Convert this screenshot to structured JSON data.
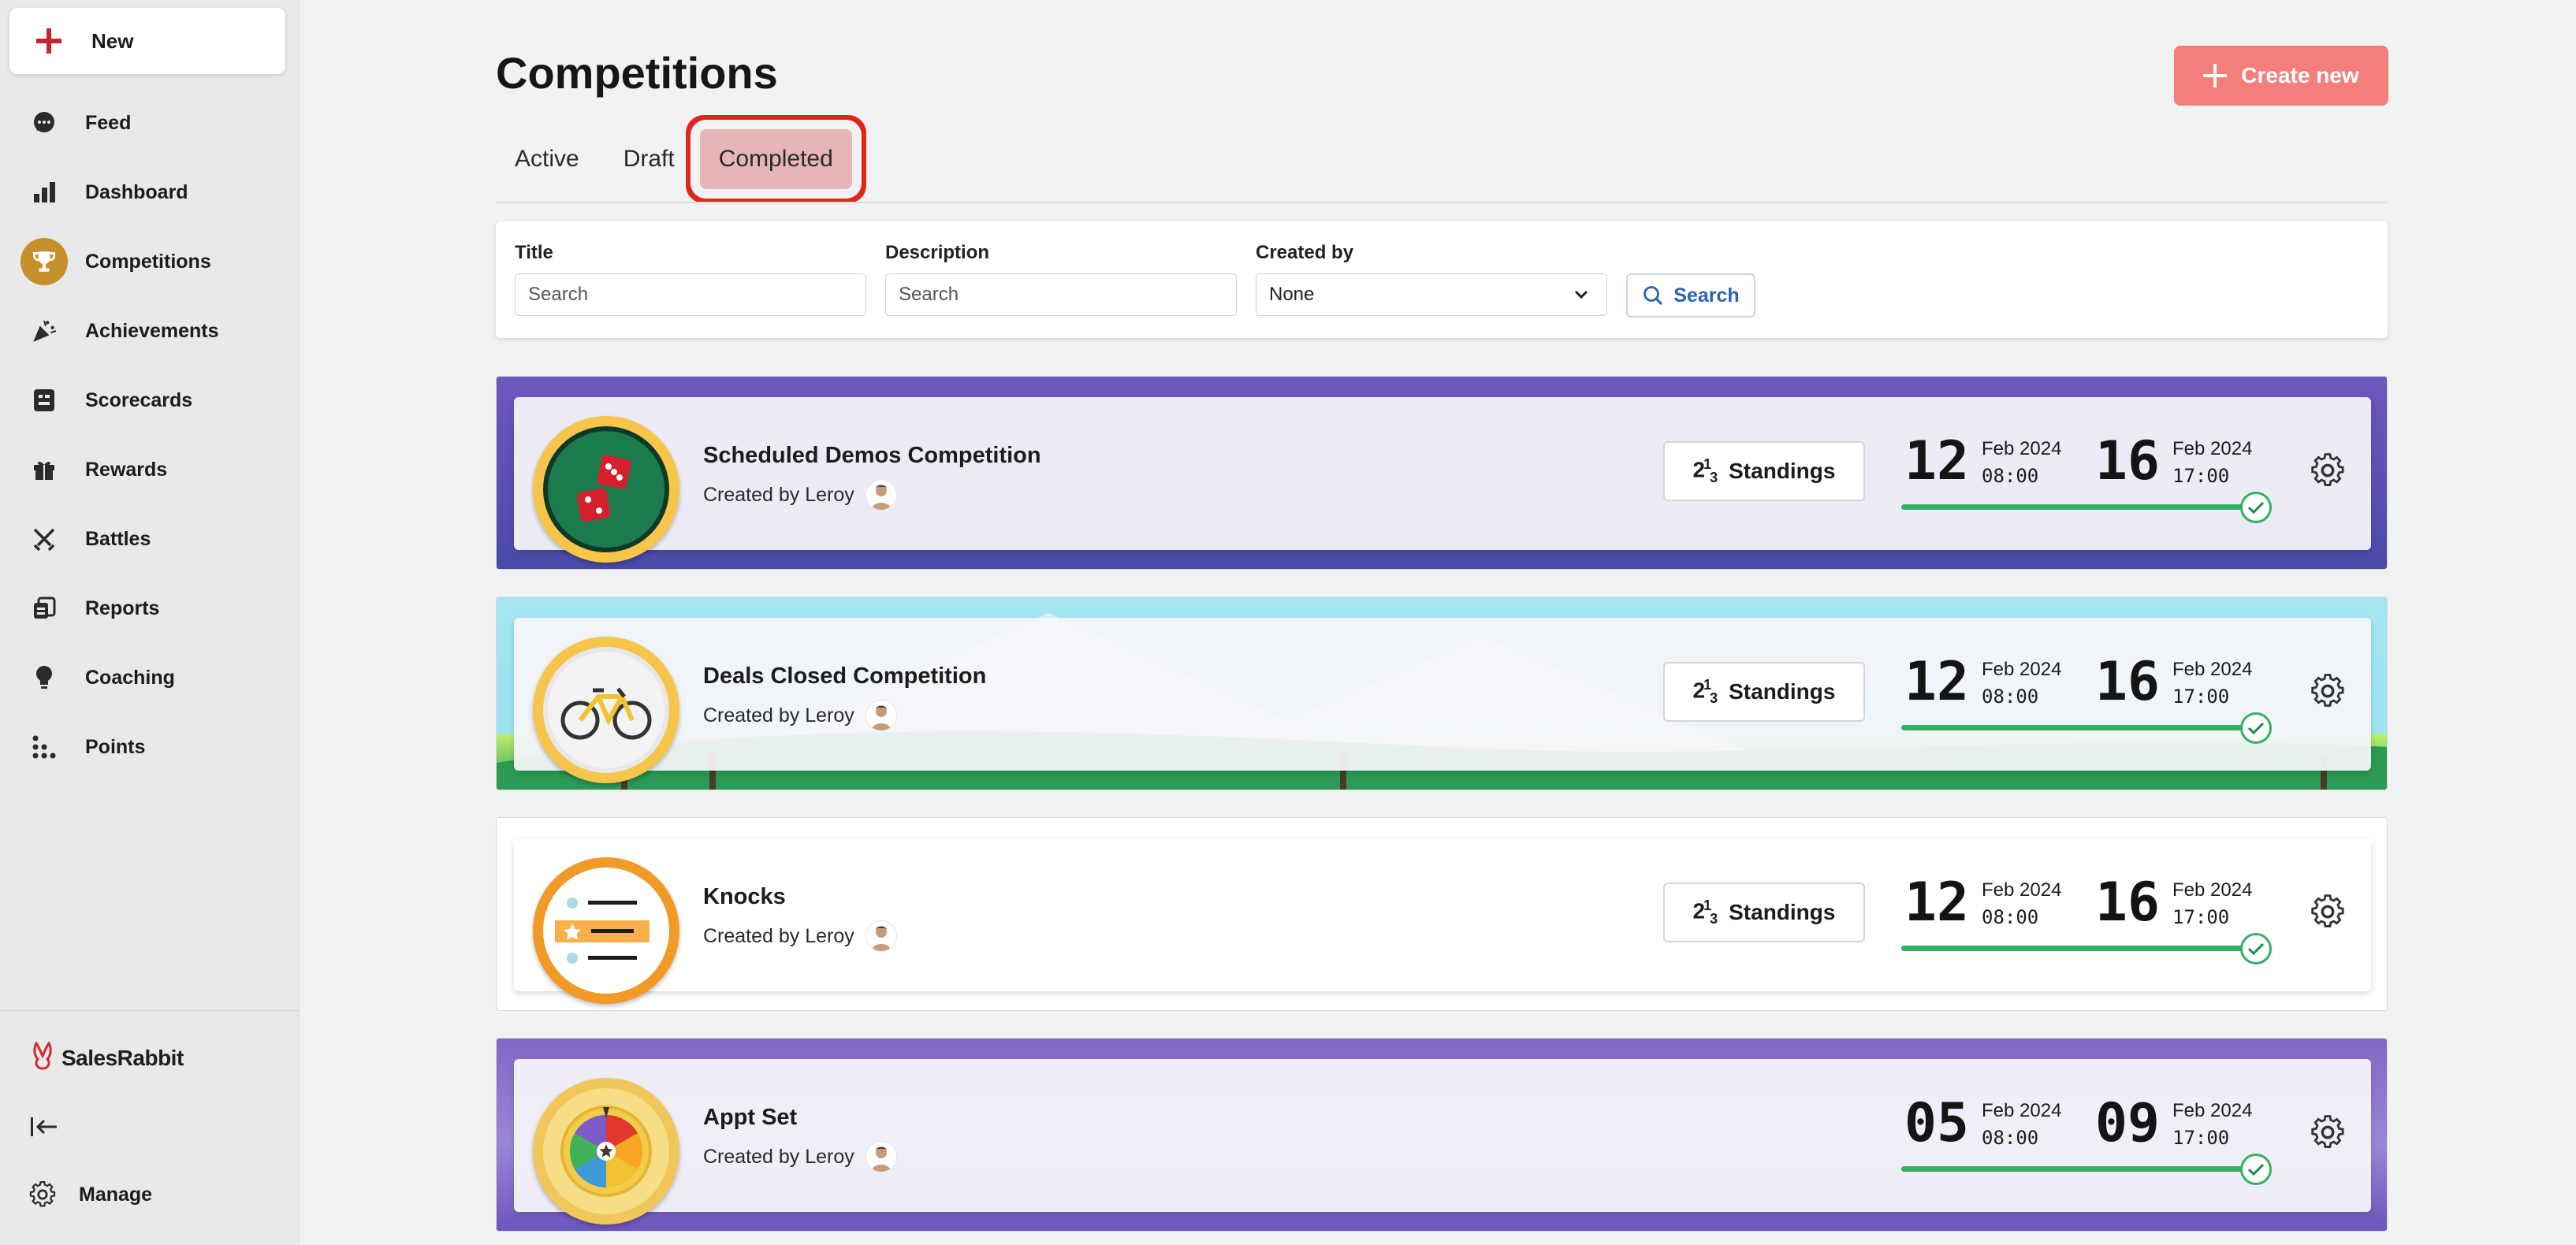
{
  "sidebar": {
    "new_label": "New",
    "items": [
      {
        "label": "Feed",
        "icon": "chat-bubble-icon"
      },
      {
        "label": "Dashboard",
        "icon": "bar-chart-icon"
      },
      {
        "label": "Competitions",
        "icon": "trophy-icon",
        "active": true
      },
      {
        "label": "Achievements",
        "icon": "party-popper-icon"
      },
      {
        "label": "Scorecards",
        "icon": "scorecard-icon"
      },
      {
        "label": "Rewards",
        "icon": "gift-icon"
      },
      {
        "label": "Battles",
        "icon": "crossed-swords-icon"
      },
      {
        "label": "Reports",
        "icon": "reports-icon"
      },
      {
        "label": "Coaching",
        "icon": "lightbulb-icon"
      },
      {
        "label": "Points",
        "icon": "dots-grid-icon"
      }
    ],
    "brand": "SalesRabbit",
    "manage_label": "Manage"
  },
  "header": {
    "title": "Competitions",
    "create_label": "Create new"
  },
  "tabs": [
    {
      "label": "Active"
    },
    {
      "label": "Draft"
    },
    {
      "label": "Completed",
      "selected": true
    }
  ],
  "filters": {
    "title_label": "Title",
    "title_placeholder": "Search",
    "description_label": "Description",
    "description_placeholder": "Search",
    "created_by_label": "Created by",
    "created_by_value": "None",
    "search_label": "Search"
  },
  "competitions": [
    {
      "name": "Scheduled Demos Competition",
      "created_by": "Created by Leroy",
      "standings_label": "Standings",
      "start_day": "12",
      "start_month": "Feb 2024",
      "start_time": "08:00",
      "end_day": "16",
      "end_month": "Feb 2024",
      "end_time": "17:00",
      "badge": "dice-icon"
    },
    {
      "name": "Deals Closed Competition",
      "created_by": "Created by Leroy",
      "standings_label": "Standings",
      "start_day": "12",
      "start_month": "Feb 2024",
      "start_time": "08:00",
      "end_day": "16",
      "end_month": "Feb 2024",
      "end_time": "17:00",
      "badge": "bicycle-icon"
    },
    {
      "name": "Knocks",
      "created_by": "Created by Leroy",
      "standings_label": "Standings",
      "start_day": "12",
      "start_month": "Feb 2024",
      "start_time": "08:00",
      "end_day": "16",
      "end_month": "Feb 2024",
      "end_time": "17:00",
      "badge": "star-list-icon"
    },
    {
      "name": "Appt Set",
      "created_by": "Created by Leroy",
      "start_day": "05",
      "start_month": "Feb 2024",
      "start_time": "08:00",
      "end_day": "09",
      "end_month": "Feb 2024",
      "end_time": "17:00",
      "badge": "prize-wheel-icon"
    }
  ],
  "colors": {
    "accent": "#f47e7c",
    "active_nav": "#c6902a",
    "progress": "#34b065",
    "highlight": "#e1261c"
  }
}
